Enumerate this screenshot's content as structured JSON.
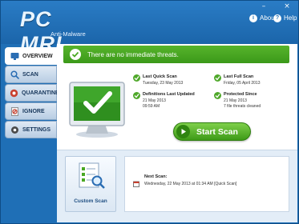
{
  "window": {
    "minimize_glyph": "–",
    "close_glyph": "×"
  },
  "header": {
    "logo_text": "PC MRI",
    "logo_subtitle": "Anti-Malware",
    "about_label": "About",
    "help_label": "Help",
    "about_icon": "info-icon",
    "help_icon": "help-icon"
  },
  "sidebar": {
    "items": [
      {
        "label": "OVERVIEW",
        "icon": "overview-icon",
        "active": true
      },
      {
        "label": "SCAN",
        "icon": "scan-icon",
        "active": false
      },
      {
        "label": "QUARANTINE",
        "icon": "quarantine-icon",
        "active": false
      },
      {
        "label": "IGNORE",
        "icon": "ignore-icon",
        "active": false
      },
      {
        "label": "SETTINGS",
        "icon": "settings-icon",
        "active": false
      }
    ]
  },
  "status": {
    "message": "There are no immediate threats.",
    "color": "#4aa823"
  },
  "info": {
    "last_quick_scan": {
      "label": "Last Quick Scan",
      "value": "Tuesday, 23 May 2013"
    },
    "last_full_scan": {
      "label": "Last Full Scan",
      "value": "Friday, 05 April 2013"
    },
    "definitions": {
      "label": "Definitions Last Updated",
      "date": "21 May 2013",
      "time": "09:59 AM"
    },
    "protected": {
      "label": "Protected Since",
      "date": "21 May 2013",
      "detail": "7 file threats cleaned"
    }
  },
  "actions": {
    "start_scan_label": "Start Scan",
    "custom_scan_label": "Custom Scan"
  },
  "next_scan": {
    "title": "Next Scan:",
    "detail": "Wednesday, 22 May 2013 at 01:34 AM   [Quick Scan]"
  },
  "colors": {
    "brand_blue": "#1f6fb6",
    "accent_green": "#4aa823"
  }
}
